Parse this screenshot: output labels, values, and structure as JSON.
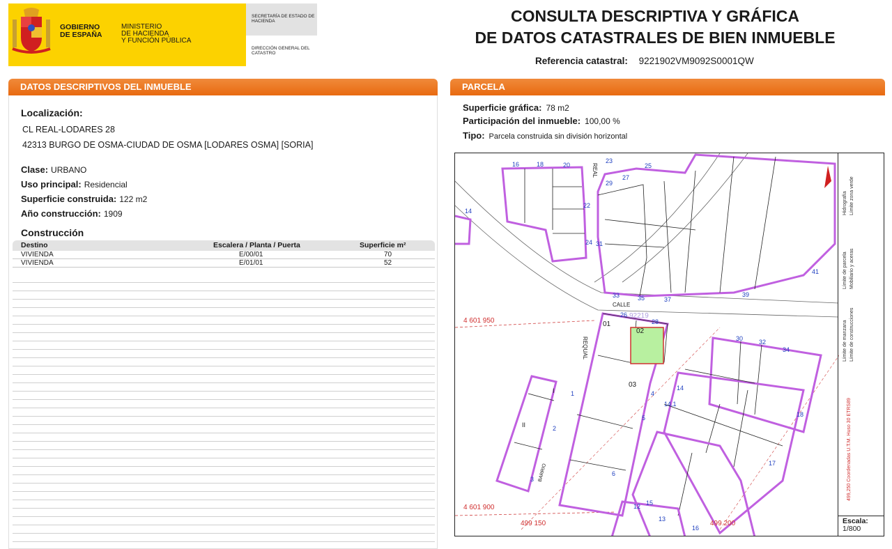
{
  "header": {
    "gov_line1": "GOBIERNO",
    "gov_line2": "DE ESPAÑA",
    "ministry_line1": "MINISTERIO",
    "ministry_line2": "DE HACIENDA",
    "ministry_line3": "Y FUNCIÓN PÚBLICA",
    "secretaria": "SECRETARÍA DE ESTADO DE HACIENDA",
    "direccion": "DIRECCIÓN GENERAL DEL CATASTRO",
    "title_line1": "CONSULTA DESCRIPTIVA Y GRÁFICA",
    "title_line2": "DE DATOS CATASTRALES DE BIEN INMUEBLE",
    "ref_label": "Referencia catastral:",
    "ref_value": "9221902VM9092S0001QW"
  },
  "descriptive": {
    "section_title_a": "DATOS DESCRIPTIVOS DEL ",
    "section_title_b": "INMUEBLE",
    "localizacion_label": "Localización:",
    "localizacion_line1": "CL REAL-LODARES 28",
    "localizacion_line2": "42313 BURGO DE OSMA-CIUDAD DE OSMA [LODARES OSMA] [SORIA]",
    "clase_label": "Clase:",
    "clase_value": "URBANO",
    "uso_label": "Uso principal:",
    "uso_value": "Residencial",
    "superficie_label": "Superficie construida:",
    "superficie_value": "122 m2",
    "anio_label": "Año construcción:",
    "anio_value": "1909",
    "construccion_title": "Construcción",
    "table": {
      "headers": [
        "Destino",
        "Escalera / Planta / Puerta",
        "Superficie m²"
      ],
      "rows": [
        [
          "VIVIENDA",
          "E/00/01",
          "70"
        ],
        [
          "VIVIENDA",
          "E/01/01",
          "52"
        ]
      ]
    }
  },
  "parcela": {
    "section_title": "PARCELA",
    "superficie_label": "Superficie gráfica:",
    "superficie_value": "78 m2",
    "participacion_label": "Participación del inmueble:",
    "participacion_value": "100,00 %",
    "tipo_label": "Tipo:",
    "tipo_value": "Parcela construida sin división horizontal"
  },
  "map": {
    "street_labels": [
      "REAL",
      "CALLE",
      "REQUAL",
      "BARRIO"
    ],
    "parcel_numbers": [
      "16",
      "18",
      "20",
      "22",
      "24",
      "23",
      "25",
      "27",
      "29",
      "31",
      "33",
      "35",
      "37",
      "39",
      "41",
      "14",
      "26",
      "28",
      "01",
      "02",
      "03",
      "30",
      "32",
      "34",
      "1",
      "2",
      "3",
      "4",
      "5",
      "6",
      "14,1",
      "14",
      "18",
      "17",
      "15",
      "13",
      "12",
      "16",
      "II",
      "I"
    ],
    "parcel_ref": "92219",
    "coord_y_top": "4 601 950",
    "coord_y_bottom": "4 601 900",
    "coord_x_left": "499 150",
    "coord_x_right": "499 200",
    "legend_items": [
      "Límite de manzana",
      "Límite de construcciones",
      "Límite de parcela",
      "Mobiliario y aceras",
      "Hidrografía",
      "Límite zona verde"
    ],
    "coord_system": "499,250 Coordenadas U.T.M. Huso 30 ETRS89",
    "scale_label": "Escala:",
    "scale_value": "1/800",
    "colors": {
      "manzana": "#c060e0",
      "construccion": "#d03030",
      "parcela": "#202020",
      "hidrografia": "#2040ff",
      "zona_verde": "#40c0e0",
      "selected_fill": "#b8f0a0",
      "header_orange": "#e86a10",
      "gov_yellow": "#fcd200"
    }
  }
}
